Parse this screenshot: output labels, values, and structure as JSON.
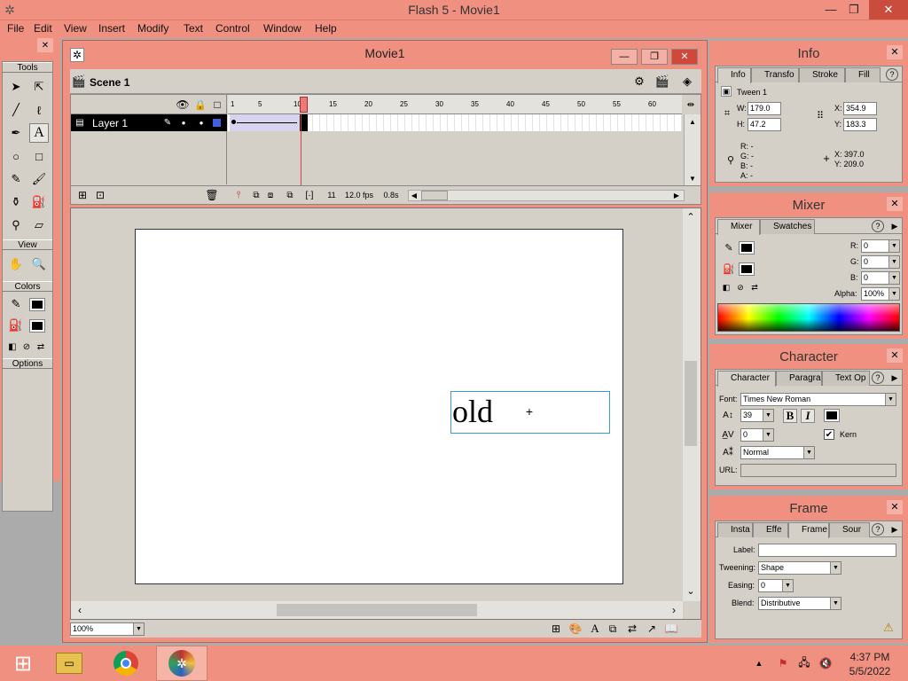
{
  "app": {
    "title": "Flash 5 - Movie1"
  },
  "menu": [
    "File",
    "Edit",
    "View",
    "Insert",
    "Modify",
    "Text",
    "Control",
    "Window",
    "Help"
  ],
  "tools": {
    "title": "Tools",
    "view_title": "View",
    "colors_title": "Colors",
    "options_title": "Options"
  },
  "movie": {
    "title": "Movie1",
    "scene": "Scene 1",
    "layer": "Layer 1",
    "ruler": [
      "1",
      "5",
      "10",
      "15",
      "20",
      "25",
      "30",
      "35",
      "40",
      "45",
      "50",
      "55",
      "60"
    ],
    "frame": "11",
    "fps": "12.0 fps",
    "time": "0.8s",
    "zoom": "100%",
    "stage_text": "old"
  },
  "info": {
    "title": "Info",
    "tabs": [
      "Info",
      "Transfo",
      "Stroke",
      "Fill"
    ],
    "symbol": "Tween 1",
    "w_label": "W:",
    "w": "179.0",
    "h_label": "H:",
    "h": "47.2",
    "x_label": "X:",
    "x": "354.9",
    "y_label": "Y:",
    "y": "183.3",
    "r": "R: -",
    "g": "G: -",
    "b": "B: -",
    "a": "A: -",
    "cx": "X: 397.0",
    "cy": "Y: 209.0"
  },
  "mixer": {
    "title": "Mixer",
    "tabs": [
      "Mixer",
      "Swatches"
    ],
    "r_label": "R:",
    "r": "0",
    "g_label": "G:",
    "g": "0",
    "b_label": "B:",
    "b": "0",
    "alpha_label": "Alpha:",
    "alpha": "100%"
  },
  "character": {
    "title": "Character",
    "tabs": [
      "Character",
      "Paragra",
      "Text Op"
    ],
    "font_label": "Font:",
    "font": "Times New Roman",
    "size": "39",
    "tracking": "0",
    "kern": "Kern",
    "baseline": "Normal",
    "url_label": "URL:"
  },
  "frame": {
    "title": "Frame",
    "tabs": [
      "Insta",
      "Effe",
      "Frame",
      "Sour"
    ],
    "label_label": "Label:",
    "tweening_label": "Tweening:",
    "tweening": "Shape",
    "easing_label": "Easing:",
    "easing": "0",
    "blend_label": "Blend:",
    "blend": "Distributive"
  },
  "taskbar": {
    "time": "4:37 PM",
    "date": "5/5/2022"
  }
}
